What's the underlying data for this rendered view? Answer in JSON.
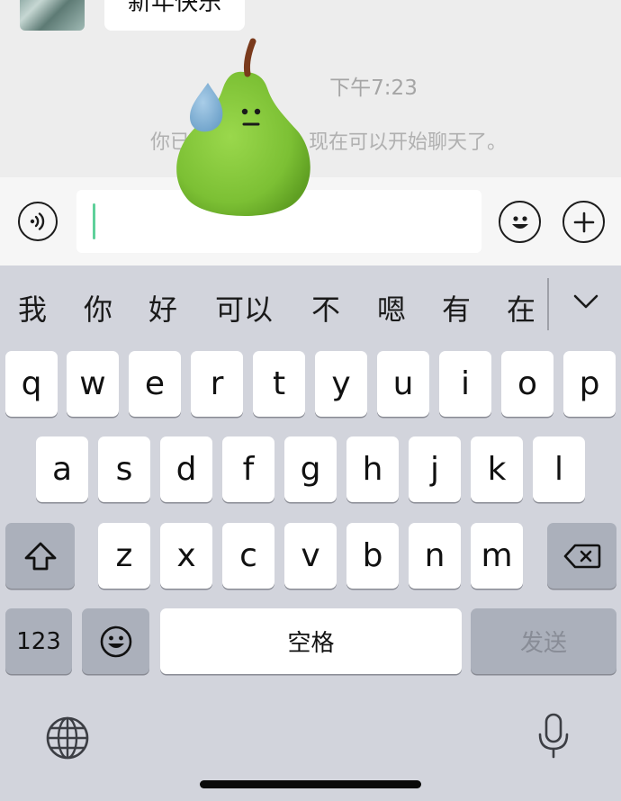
{
  "chat": {
    "last_message": "新年快乐",
    "timestamp": "下午7:23",
    "system_message": "你已添加了对方，现在可以开始聊天了。"
  },
  "input_bar": {
    "voice_icon": "voice-icon",
    "emoji_icon": "emoji-icon",
    "plus_icon": "plus-icon",
    "input_value": ""
  },
  "keyboard": {
    "candidates": [
      "我",
      "你",
      "好",
      "可以",
      "不",
      "嗯",
      "有",
      "在"
    ],
    "expand_icon": "chevron-down-icon",
    "row1": [
      "q",
      "w",
      "e",
      "r",
      "t",
      "y",
      "u",
      "i",
      "o",
      "p"
    ],
    "row2": [
      "a",
      "s",
      "d",
      "f",
      "g",
      "h",
      "j",
      "k",
      "l"
    ],
    "row3": [
      "z",
      "x",
      "c",
      "v",
      "b",
      "n",
      "m"
    ],
    "numbers_label": "123",
    "space_label": "空格",
    "send_label": "发送"
  },
  "colors": {
    "chat_bg": "#ededed",
    "keyboard_bg": "#d2d4dc",
    "caret": "#5fd09a",
    "pear": "#86c93a"
  }
}
